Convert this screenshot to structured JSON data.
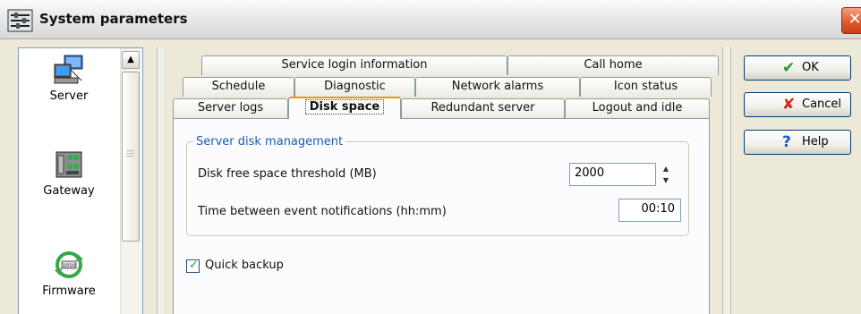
{
  "window": {
    "title": "System parameters"
  },
  "nav": {
    "items": [
      {
        "label": "Server",
        "icon": "server-icon"
      },
      {
        "label": "Gateway",
        "icon": "gateway-icon"
      },
      {
        "label": "Firmware",
        "icon": "firmware-icon"
      }
    ]
  },
  "tabs": {
    "row1": [
      "Service login information",
      "Call home"
    ],
    "row2": [
      "Schedule",
      "Diagnostic",
      "Network alarms",
      "Icon status"
    ],
    "row3": [
      "Server logs",
      "Disk space",
      "Redundant server",
      "Logout and idle"
    ],
    "active": "Disk space"
  },
  "disk": {
    "group_title": "Server disk management",
    "threshold_label": "Disk free space threshold (MB)",
    "threshold_value": "2000",
    "notify_label": "Time between event notifications (hh:mm)",
    "notify_value": "00:10",
    "quick_backup_label": "Quick backup",
    "quick_backup_checked": true
  },
  "buttons": {
    "ok": "OK",
    "cancel": "Cancel",
    "help": "Help"
  },
  "colors": {
    "accent_blue": "#1c5ab0",
    "active_tab_top": "#e69a1a",
    "close_red": "#e35b2c"
  }
}
